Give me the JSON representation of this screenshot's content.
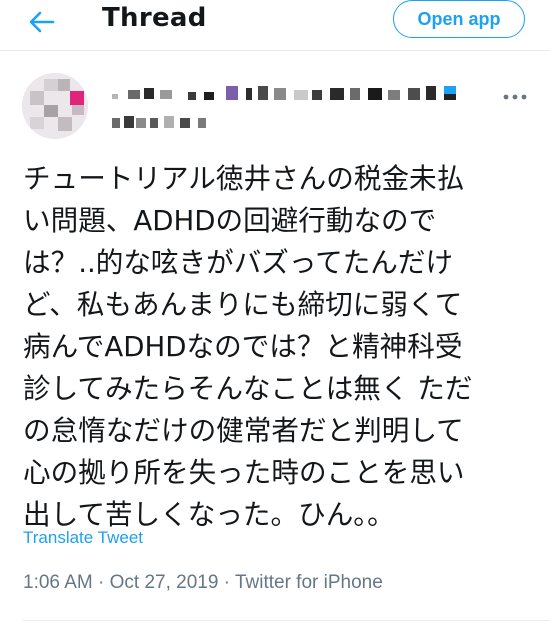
{
  "header": {
    "title": "Thread",
    "open_app_label": "Open app"
  },
  "tweet": {
    "text": "チュートリアル徳井さんの税金未払\nい問題、ADHDの回避行動なので\nは？..的な呟きがバズってたんだけ\nど、私もあんまりにも締切に弱くて\n病んでADHDなのでは？と精神科受\n診してみたらそんなことは無く ただ\nの怠惰なだけの健常者だと判明して\n心の拠り所を失った時のことを思い\n出して苦しくなった。ひん。。",
    "translate_label": "Translate Tweet",
    "time": "1:06 AM",
    "date": "Oct 27, 2019",
    "source": "Twitter for iPhone",
    "separator": " · "
  },
  "icons": {
    "back": "arrow-left-icon",
    "more": "more-horizontal-icon"
  },
  "colors": {
    "accent": "#1da1f2",
    "text": "#14171a",
    "secondary": "#657786",
    "divider": "#e6ecf0"
  }
}
